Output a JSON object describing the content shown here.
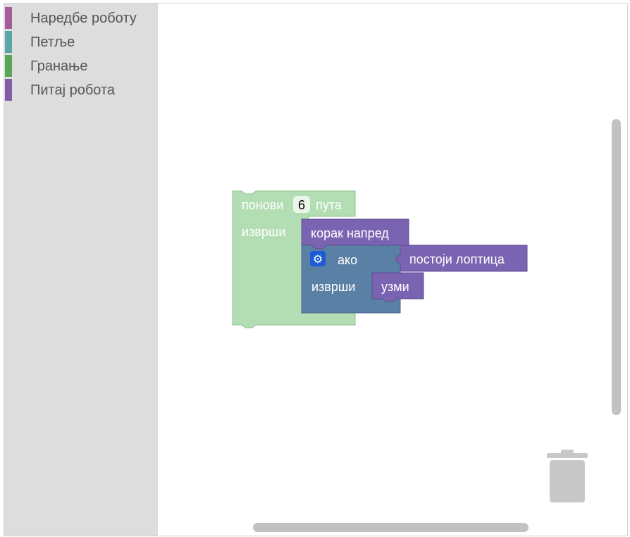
{
  "toolbox": {
    "categories": [
      {
        "label": "Наредбе роботу",
        "color": "#a55b99"
      },
      {
        "label": "Петље",
        "color": "#5ba5a5"
      },
      {
        "label": "Гранање",
        "color": "#5ba55b"
      },
      {
        "label": "Питај робота",
        "color": "#865ba5"
      }
    ]
  },
  "workspace": {
    "repeat_block": {
      "label_repeat": "понови",
      "count": "6",
      "label_times": "пута",
      "label_do": "изврши",
      "color": "#b3ddb3"
    },
    "forward_block": {
      "label": "корак напред",
      "color": "#7a64b2"
    },
    "if_block": {
      "label_if": "ако",
      "label_do": "изврши",
      "color": "#5b80a5"
    },
    "condition_block": {
      "label": "постоји лоптица",
      "color": "#7a64b2"
    },
    "take_block": {
      "label": "узми",
      "color": "#7a64b2"
    }
  },
  "icons": {
    "gear": "gear-icon",
    "trash": "trash-icon"
  }
}
